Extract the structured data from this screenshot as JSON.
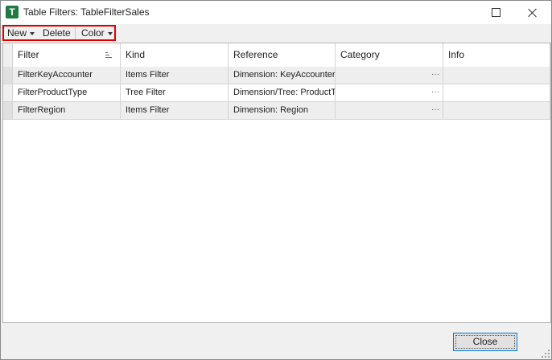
{
  "window": {
    "app_icon_letter": "T",
    "title": "Table Filters: TableFilterSales"
  },
  "toolbar": {
    "new_label": "New",
    "delete_label": "Delete",
    "color_label": "Color"
  },
  "grid": {
    "columns": [
      "Filter",
      "Kind",
      "Reference",
      "Category",
      "Info"
    ],
    "rows": [
      {
        "filter": "FilterKeyAccounter",
        "kind": "Items Filter",
        "reference": "Dimension: KeyAccounter",
        "category": "",
        "info": ""
      },
      {
        "filter": "FilterProductType",
        "kind": "Tree Filter",
        "reference": "Dimension/Tree: ProductType",
        "category": "",
        "info": ""
      },
      {
        "filter": "FilterRegion",
        "kind": "Items Filter",
        "reference": "Dimension: Region",
        "category": "",
        "info": ""
      }
    ],
    "category_button_glyph": "···"
  },
  "footer": {
    "close_label": "Close"
  },
  "colors": {
    "highlight": "#e00000",
    "app_icon": "#1f7a43",
    "focus_border": "#0078d7"
  }
}
